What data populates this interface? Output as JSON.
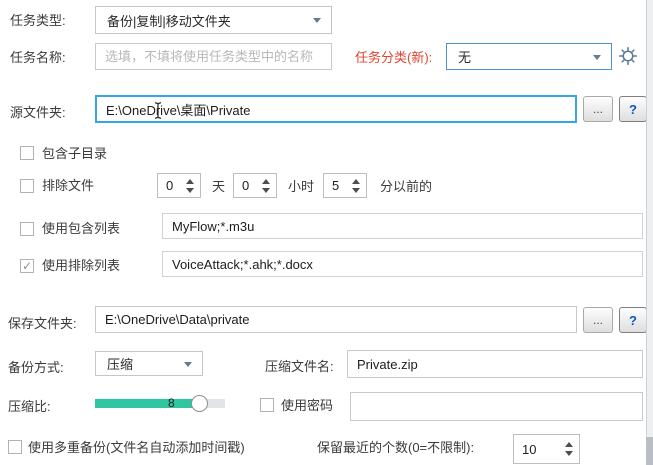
{
  "colors": {
    "focus_border": "#38a6e3",
    "accent_red": "#e0442f",
    "slider_fill": "#2fc6a1",
    "category_border": "#4a90d2",
    "help_blue": "#0a58c0"
  },
  "icons": {
    "checkmark": "✓",
    "browse": "...",
    "help": "?"
  },
  "form": {
    "task_type": {
      "label": "任务类型:",
      "value": "备份|复制|移动文件夹"
    },
    "task_name": {
      "label": "任务名称:",
      "placeholder": "选填，不填将使用任务类型中的名称"
    },
    "task_category": {
      "label": "任务分类(新):",
      "value": "无"
    },
    "source_folder": {
      "label": "源文件夹:",
      "value": "E:\\OneDrive\\桌面\\Private"
    },
    "include_subdirs": {
      "label": "包含子目录",
      "checked": false
    },
    "exclude_old": {
      "label": "排除文件",
      "checked": false,
      "days": "0",
      "unit_days": "天",
      "hours": "0",
      "unit_hours": "小时",
      "minutes": "5",
      "suffix": "分以前的"
    },
    "include_list": {
      "label": "使用包含列表",
      "checked": false,
      "value": "MyFlow;*.m3u"
    },
    "exclude_list": {
      "label": "使用排除列表",
      "checked": true,
      "value": "VoiceAttack;*.ahk;*.docx"
    },
    "save_folder": {
      "label": "保存文件夹:",
      "value": "E:\\OneDrive\\Data\\private"
    },
    "backup_method": {
      "label": "备份方式:",
      "value": "压缩"
    },
    "zip_name": {
      "label": "压缩文件名:",
      "value": "Private.zip"
    },
    "compression": {
      "label": "压缩比:",
      "value": "8"
    },
    "password": {
      "label": "使用密码",
      "checked": false,
      "value": ""
    },
    "multi_backup": {
      "label": "使用多重备份(文件名自动添加时间戳)",
      "checked": false
    },
    "keep_count": {
      "label": "保留最近的个数(0=不限制):",
      "value": "10"
    }
  }
}
